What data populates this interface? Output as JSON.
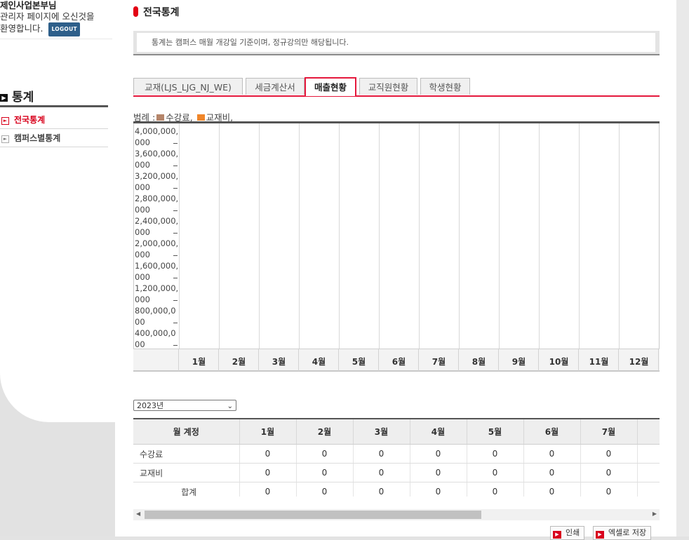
{
  "sidebar": {
    "org_name": "제인사업본부님",
    "welcome_line1": "관리자 페이지에 오신것을",
    "welcome_line2": "환영합니다.",
    "logout_label": "LOGOUT",
    "menu_title": "통계",
    "items": [
      {
        "label": "전국통계",
        "active": true
      },
      {
        "label": "캠퍼스별통계",
        "active": false
      }
    ]
  },
  "header": {
    "title": "전국통계"
  },
  "notice": "통계는 캠퍼스 매월 개강일 기준이며, 정규강의만 해당됩니다.",
  "tabs": [
    {
      "label": "교재(LJS_LJG_NJ_WE)",
      "active": false
    },
    {
      "label": "세금계산서",
      "active": false
    },
    {
      "label": "매출현황",
      "active": true
    },
    {
      "label": "교직원현황",
      "active": false
    },
    {
      "label": "학생현황",
      "active": false
    }
  ],
  "legend": {
    "prefix": "범례 :",
    "items": [
      {
        "label": "수강료,",
        "color": "#b5856a"
      },
      {
        "label": "교재비,",
        "color": "#f0862a"
      }
    ]
  },
  "chart_data": {
    "type": "bar",
    "categories": [
      "1월",
      "2월",
      "3월",
      "4월",
      "5월",
      "6월",
      "7월",
      "8월",
      "9월",
      "10월",
      "11월",
      "12월"
    ],
    "series": [
      {
        "name": "수강료",
        "values": [
          0,
          0,
          0,
          0,
          0,
          0,
          0,
          0,
          0,
          0,
          0,
          0
        ]
      },
      {
        "name": "교재비",
        "values": [
          0,
          0,
          0,
          0,
          0,
          0,
          0,
          0,
          0,
          0,
          0,
          0
        ]
      }
    ],
    "yticks": [
      "4,000,000,000",
      "3,600,000,000",
      "3,200,000,000",
      "2,800,000,000",
      "2,400,000,000",
      "2,000,000,000",
      "1,600,000,000",
      "1,200,000,000",
      "800,000,000",
      "400,000,000"
    ],
    "ylim": [
      0,
      4000000000
    ],
    "legend": "top-left"
  },
  "year_select": {
    "value": "2023년"
  },
  "table": {
    "header_first": "월 계정",
    "months": [
      "1월",
      "2월",
      "3월",
      "4월",
      "5월",
      "6월",
      "7월"
    ],
    "rows": [
      {
        "label": "수강료",
        "values": [
          "0",
          "0",
          "0",
          "0",
          "0",
          "0",
          "0"
        ]
      },
      {
        "label": "교재비",
        "values": [
          "0",
          "0",
          "0",
          "0",
          "0",
          "0",
          "0"
        ]
      },
      {
        "label": "합계",
        "values": [
          "0",
          "0",
          "0",
          "0",
          "0",
          "0",
          "0"
        ]
      }
    ]
  },
  "buttons": {
    "print": "인쇄",
    "excel": "엑셀로 저장"
  }
}
